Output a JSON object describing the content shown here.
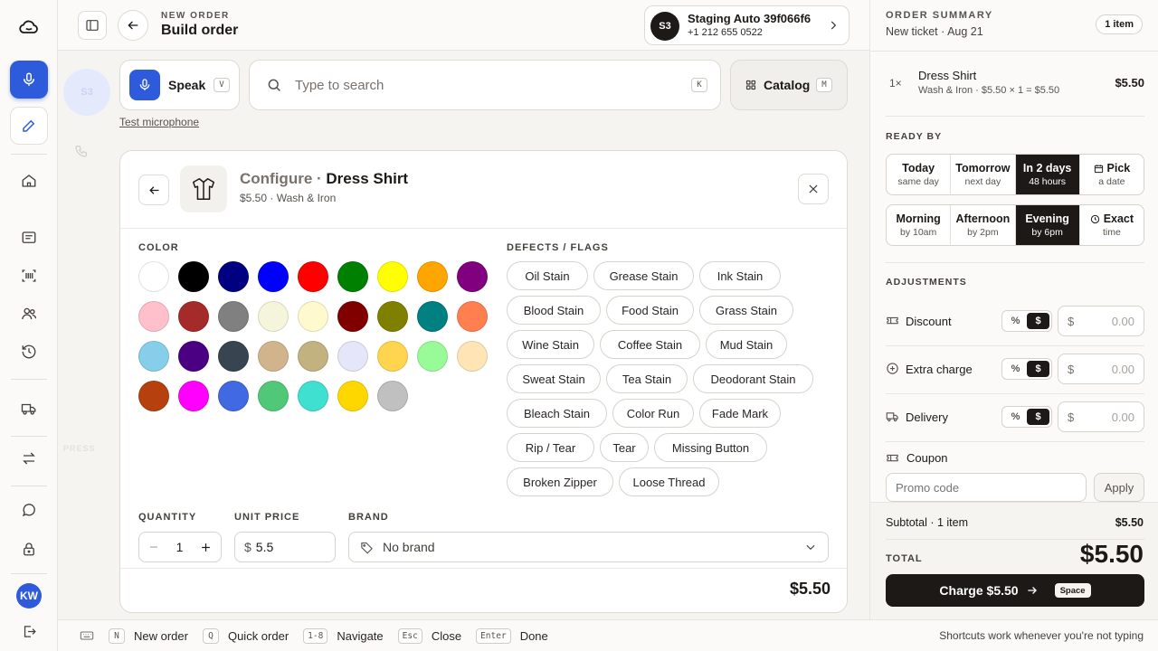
{
  "header": {
    "eyebrow": "NEW ORDER",
    "title": "Build order",
    "customer": {
      "initials": "S3",
      "name": "Staging Auto 39f066f6",
      "phone": "+1 212 655 0522"
    }
  },
  "rail": {
    "avatar_initials": "KW"
  },
  "ghost": {
    "avatar": "S3",
    "label": "PRESS"
  },
  "toolbar": {
    "speak_label": "Speak",
    "speak_key": "V",
    "search_placeholder": "Type to search",
    "search_key": "K",
    "catalog_label": "Catalog",
    "catalog_key": "M",
    "test_mic": "Test microphone"
  },
  "configure": {
    "prefix": "Configure · ",
    "item_name": "Dress Shirt",
    "subtitle": "$5.50 · Wash & Iron",
    "color_label": "COLOR",
    "colors": [
      "#ffffff",
      "#000000",
      "#000080",
      "#0000ff",
      "#ff0000",
      "#008000",
      "#ffff00",
      "#ffa500",
      "#800080",
      "#ffc0cb",
      "#a52a2a",
      "#808080",
      "#f5f5dc",
      "#fffacd",
      "#800000",
      "#808000",
      "#008080",
      "#ff7f50",
      "#87ceeb",
      "#4b0082",
      "#36454f",
      "#d2b48c",
      "#c2b280",
      "#e6e6fa",
      "#ffd54f",
      "#98fb98",
      "#ffe4b5",
      "#b7410e",
      "#ff00ff",
      "#4169e1",
      "#50c878",
      "#40e0d0",
      "#ffd700",
      "#c0c0c0"
    ],
    "defects_label": "DEFECTS / FLAGS",
    "defect_rows": [
      [
        "Oil Stain",
        "Grease Stain",
        "Ink Stain"
      ],
      [
        "Blood Stain",
        "Food Stain",
        "Grass Stain"
      ],
      [
        "Wine Stain",
        "Coffee Stain",
        "Mud Stain"
      ],
      [
        "Sweat Stain",
        "Tea Stain",
        "Deodorant Stain"
      ],
      [
        "Bleach Stain",
        "Color Run",
        "Fade Mark"
      ],
      [
        "Rip / Tear",
        "Tear",
        "Missing Button"
      ],
      [
        "Broken Zipper",
        "Loose Thread"
      ]
    ],
    "quantity_label": "QUANTITY",
    "quantity": "1",
    "unit_price_label": "UNIT PRICE",
    "currency": "$",
    "unit_price": "5.5",
    "brand_label": "BRAND",
    "brand_value": "No brand",
    "total": "$5.50"
  },
  "summary": {
    "title": "ORDER SUMMARY",
    "subtitle": "New ticket · Aug 21",
    "count_badge": "1 item",
    "line": {
      "qty": "1×",
      "name": "Dress Shirt",
      "detail": "Wash & Iron · $5.50 × 1 = $5.50",
      "price": "$5.50"
    },
    "ready_by_label": "READY BY",
    "ready_days": [
      {
        "t": "Today",
        "s": "same day"
      },
      {
        "t": "Tomorrow",
        "s": "next day"
      },
      {
        "t": "In 2 days",
        "s": "48 hours"
      },
      {
        "t": "Pick",
        "s": "a date"
      }
    ],
    "ready_times": [
      {
        "t": "Morning",
        "s": "by 10am"
      },
      {
        "t": "Afternoon",
        "s": "by 2pm"
      },
      {
        "t": "Evening",
        "s": "by 6pm"
      },
      {
        "t": "Exact",
        "s": "time"
      }
    ],
    "adjustments_label": "ADJUSTMENTS",
    "adjustments": [
      {
        "label": "Discount",
        "pct": "%",
        "dollar": "$",
        "currency": "$",
        "placeholder": "0.00"
      },
      {
        "label": "Extra charge",
        "pct": "%",
        "dollar": "$",
        "currency": "$",
        "placeholder": "0.00"
      },
      {
        "label": "Delivery",
        "pct": "%",
        "dollar": "$",
        "currency": "$",
        "placeholder": "0.00"
      }
    ],
    "coupon_label": "Coupon",
    "promo_placeholder": "Promo code",
    "apply_label": "Apply",
    "subtotal_label": "Subtotal · 1 item",
    "subtotal": "$5.50",
    "total_label": "TOTAL",
    "total": "$5.50",
    "charge_label": "Charge $5.50",
    "charge_key": "Space"
  },
  "shortcuts": [
    {
      "key": "N",
      "label": "New order"
    },
    {
      "key": "Q",
      "label": "Quick order"
    },
    {
      "key": "1-8",
      "label": "Navigate"
    },
    {
      "key": "Esc",
      "label": "Close"
    },
    {
      "key": "Enter",
      "label": "Done"
    }
  ],
  "shortcuts_hint": "Shortcuts work whenever you're not typing"
}
